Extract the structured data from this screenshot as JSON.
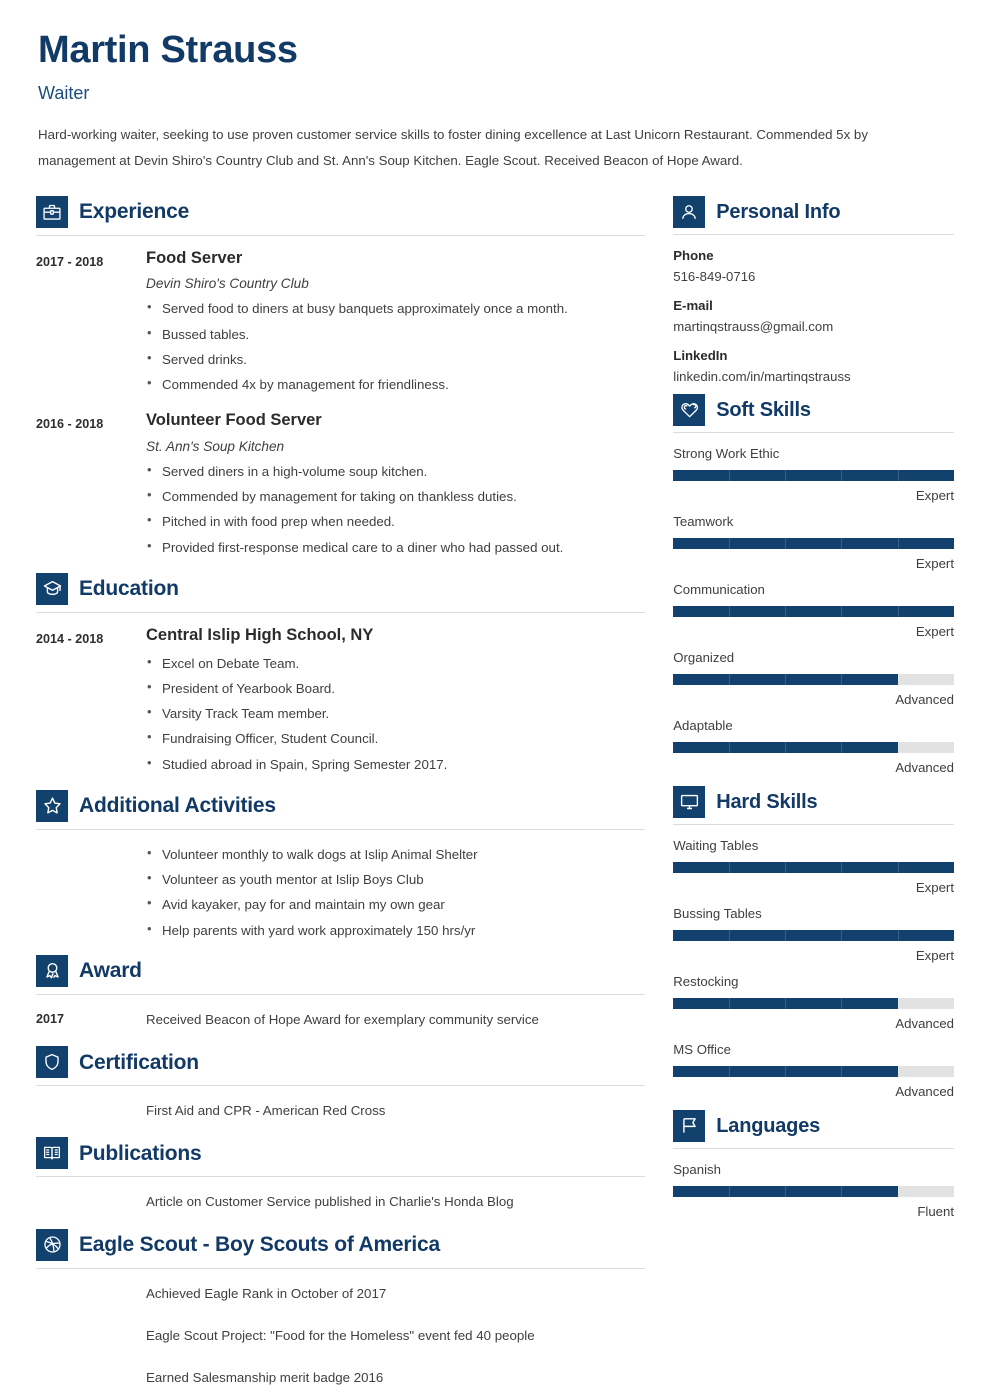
{
  "header": {
    "name": "Martin Strauss",
    "job_title": "Waiter",
    "summary": "Hard-working waiter, seeking to use proven customer service skills to foster dining excellence at Last Unicorn Restaurant. Commended 5x by management at Devin Shiro's Country Club and St. Ann's Soup Kitchen. Eagle Scout. Received Beacon of Hope Award."
  },
  "colors": {
    "accent": "#12416e",
    "heading": "#123a66",
    "bar_track": "#e2e2e2",
    "rule": "#dcdcdc"
  },
  "sections": {
    "experience": {
      "title": "Experience",
      "icon": "briefcase-icon",
      "entries": [
        {
          "date": "2017 - 2018",
          "role": "Food Server",
          "org": "Devin Shiro's Country Club",
          "bullets": [
            "Served food to diners at busy banquets approximately once a month.",
            "Bussed tables.",
            "Served drinks.",
            "Commended 4x by management for friendliness."
          ]
        },
        {
          "date": "2016 - 2018",
          "role": "Volunteer Food Server",
          "org": "St. Ann's Soup Kitchen",
          "bullets": [
            "Served diners in a high-volume soup kitchen.",
            "Commended by management for taking on thankless duties.",
            "Pitched in with food prep when needed.",
            "Provided first-response medical care to a diner who had passed out."
          ]
        }
      ]
    },
    "education": {
      "title": "Education",
      "icon": "graduation-cap-icon",
      "entries": [
        {
          "date": "2014 - 2018",
          "role": "Central Islip High School, NY",
          "bullets": [
            "Excel on Debate Team.",
            "President of Yearbook Board.",
            "Varsity Track Team member.",
            "Fundraising Officer, Student Council.",
            "Studied abroad in Spain, Spring Semester 2017."
          ]
        }
      ]
    },
    "additional_activities": {
      "title": "Additional Activities",
      "icon": "star-icon",
      "bullets": [
        "Volunteer monthly to walk dogs at Islip Animal Shelter",
        "Volunteer as youth mentor at Islip Boys Club",
        "Avid kayaker, pay for and maintain my own gear",
        "Help parents with yard work approximately 150 hrs/yr"
      ]
    },
    "award": {
      "title": "Award",
      "icon": "ribbon-award-icon",
      "date": "2017",
      "text": "Received Beacon of Hope Award for exemplary community service"
    },
    "certification": {
      "title": "Certification",
      "icon": "shield-icon",
      "text": "First Aid and CPR - American Red Cross"
    },
    "publications": {
      "title": "Publications",
      "icon": "open-book-icon",
      "text": "Article on Customer Service published in Charlie's Honda Blog"
    },
    "eagle_scout": {
      "title": "Eagle Scout - Boy Scouts of America",
      "icon": "ball-icon",
      "lines": [
        "Achieved Eagle Rank in October of 2017",
        "Eagle Scout Project: \"Food for the Homeless\" event fed 40 people",
        "Earned Salesmanship merit badge 2016"
      ]
    },
    "personal_info": {
      "title": "Personal Info",
      "icon": "person-icon",
      "fields": [
        {
          "label": "Phone",
          "value": "516-849-0716"
        },
        {
          "label": "E-mail",
          "value": "martinqstrauss@gmail.com"
        },
        {
          "label": "LinkedIn",
          "value": "linkedin.com/in/martinqstrauss"
        }
      ]
    },
    "soft_skills": {
      "title": "Soft Skills",
      "icon": "heart-swirl-icon",
      "items": [
        {
          "name": "Strong Work Ethic",
          "level": "Expert",
          "percent": 100
        },
        {
          "name": "Teamwork",
          "level": "Expert",
          "percent": 100
        },
        {
          "name": "Communication",
          "level": "Expert",
          "percent": 100
        },
        {
          "name": "Organized",
          "level": "Advanced",
          "percent": 80
        },
        {
          "name": "Adaptable",
          "level": "Advanced",
          "percent": 80
        }
      ]
    },
    "hard_skills": {
      "title": "Hard Skills",
      "icon": "monitor-icon",
      "items": [
        {
          "name": "Waiting Tables",
          "level": "Expert",
          "percent": 100
        },
        {
          "name": "Bussing Tables",
          "level": "Expert",
          "percent": 100
        },
        {
          "name": "Restocking",
          "level": "Advanced",
          "percent": 80
        },
        {
          "name": "MS Office",
          "level": "Advanced",
          "percent": 80
        }
      ]
    },
    "languages": {
      "title": "Languages",
      "icon": "flag-icon",
      "items": [
        {
          "name": "Spanish",
          "level": "Fluent",
          "percent": 80
        }
      ]
    }
  }
}
